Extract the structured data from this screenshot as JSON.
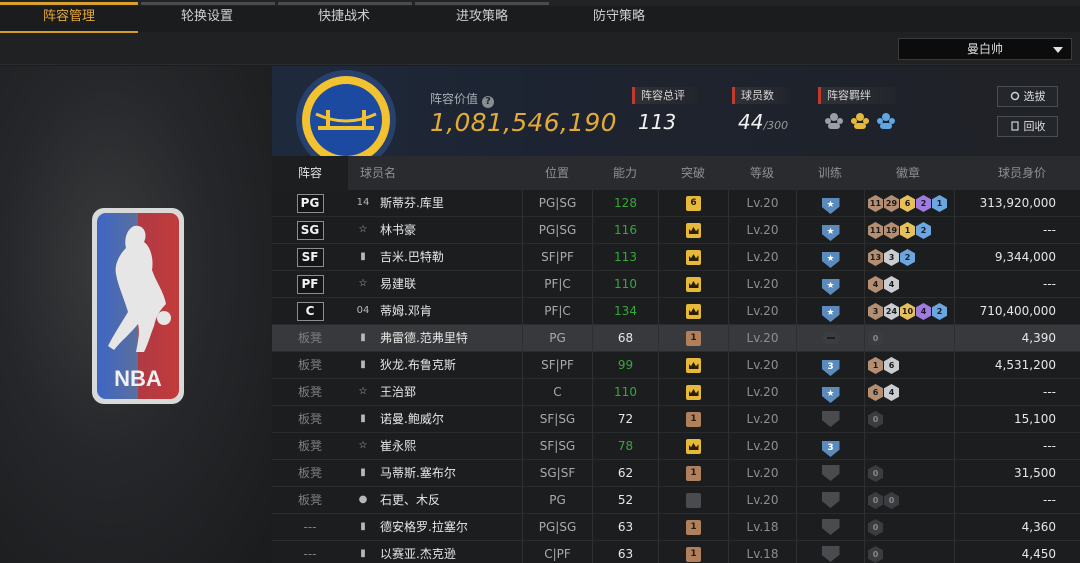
{
  "tabs": [
    "阵容管理",
    "轮换设置",
    "快捷战术",
    "进攻策略",
    "防守策略"
  ],
  "active_tab": 0,
  "dropdown": {
    "value": "曼白帅"
  },
  "header": {
    "value_label": "阵容价值",
    "value_amount": "1,081,546,190",
    "overall_label": "阵容总评",
    "overall_value": "113",
    "players_label": "球员数",
    "players_value": "44",
    "players_max": "/300",
    "bond_label": "阵容羁绊",
    "scout_button": "选拔",
    "recycle_button": "回收"
  },
  "columns": [
    "阵容",
    "球员名",
    "位置",
    "能力",
    "突破",
    "等级",
    "训练",
    "徽章",
    "球员身价"
  ],
  "colors": {
    "accent": "#d99b28",
    "value_gold": "#e3ab36",
    "green": "#35a83a"
  },
  "rows": [
    {
      "slot": "PG",
      "starter": true,
      "icon": "14",
      "name": "斯蒂芬.库里",
      "pos": "PG|SG",
      "ability": "128",
      "ability_green": true,
      "break": "6",
      "break_type": "gold-num",
      "level": "Lv.20",
      "train": "shield-star",
      "badges": [
        [
          "b",
          "11"
        ],
        [
          "b",
          "29"
        ],
        [
          "g",
          "6"
        ],
        [
          "p",
          "2"
        ],
        [
          "blue",
          "1"
        ]
      ],
      "price": "313,920,000"
    },
    {
      "slot": "SG",
      "starter": true,
      "icon": "star",
      "name": "林书豪",
      "pos": "PG|SG",
      "ability": "116",
      "ability_green": true,
      "break": "",
      "break_type": "gold-crown",
      "level": "Lv.20",
      "train": "shield-star",
      "badges": [
        [
          "b",
          "11"
        ],
        [
          "b",
          "19"
        ],
        [
          "g",
          "1"
        ],
        [
          "blue",
          "2"
        ]
      ],
      "price": "---"
    },
    {
      "slot": "SF",
      "starter": true,
      "icon": "bars",
      "name": "吉米.巴特勒",
      "pos": "SF|PF",
      "ability": "113",
      "ability_green": true,
      "break": "",
      "break_type": "gold-crown",
      "level": "Lv.20",
      "train": "shield-star",
      "badges": [
        [
          "b",
          "13"
        ],
        [
          "s",
          "3"
        ],
        [
          "blue",
          "2"
        ]
      ],
      "price": "9,344,000"
    },
    {
      "slot": "PF",
      "starter": true,
      "icon": "star",
      "name": "易建联",
      "pos": "PF|C",
      "ability": "110",
      "ability_green": true,
      "break": "",
      "break_type": "gold-crown",
      "level": "Lv.20",
      "train": "shield-star",
      "badges": [
        [
          "b",
          "4"
        ],
        [
          "s",
          "4"
        ]
      ],
      "price": "---"
    },
    {
      "slot": "C",
      "starter": true,
      "icon": "04",
      "name": "蒂姆.邓肯",
      "pos": "PF|C",
      "ability": "134",
      "ability_green": true,
      "break": "",
      "break_type": "gold-crown",
      "level": "Lv.20",
      "train": "shield-star",
      "badges": [
        [
          "b",
          "3"
        ],
        [
          "s",
          "24"
        ],
        [
          "g",
          "10"
        ],
        [
          "p",
          "4"
        ],
        [
          "blue",
          "2"
        ]
      ],
      "price": "710,400,000"
    },
    {
      "slot": "板凳",
      "starter": false,
      "icon": "bars",
      "name": "弗雷德.范弗里特",
      "pos": "PG",
      "ability": "68",
      "ability_green": false,
      "break": "1",
      "break_type": "bronze",
      "level": "Lv.20",
      "train": "dash",
      "badges": [
        [
          "z",
          "0"
        ]
      ],
      "price": "4,390",
      "highlight": true
    },
    {
      "slot": "板凳",
      "starter": false,
      "icon": "bars",
      "name": "狄龙.布鲁克斯",
      "pos": "SF|PF",
      "ability": "99",
      "ability_green": true,
      "break": "",
      "break_type": "gold-crown",
      "level": "Lv.20",
      "train": "shield-3",
      "badges": [
        [
          "b",
          "1"
        ],
        [
          "s",
          "6"
        ]
      ],
      "price": "4,531,200"
    },
    {
      "slot": "板凳",
      "starter": false,
      "icon": "star",
      "name": "王治郅",
      "pos": "C",
      "ability": "110",
      "ability_green": true,
      "break": "",
      "break_type": "gold-crown",
      "level": "Lv.20",
      "train": "shield-star",
      "badges": [
        [
          "b",
          "6"
        ],
        [
          "s",
          "4"
        ]
      ],
      "price": "---"
    },
    {
      "slot": "板凳",
      "starter": false,
      "icon": "bars",
      "name": "诺曼.鲍威尔",
      "pos": "SF|SG",
      "ability": "72",
      "ability_green": false,
      "break": "1",
      "break_type": "bronze",
      "level": "Lv.20",
      "train": "shield-dim",
      "badges": [
        [
          "z",
          "0"
        ]
      ],
      "price": "15,100"
    },
    {
      "slot": "板凳",
      "starter": false,
      "icon": "star",
      "name": "崔永熙",
      "pos": "SF|SG",
      "ability": "78",
      "ability_green": true,
      "break": "",
      "break_type": "gold-crown",
      "level": "Lv.20",
      "train": "shield-3",
      "badges": [],
      "price": "---"
    },
    {
      "slot": "板凳",
      "starter": false,
      "icon": "bars",
      "name": "马蒂斯.塞布尔",
      "pos": "SG|SF",
      "ability": "62",
      "ability_green": false,
      "break": "1",
      "break_type": "bronze",
      "level": "Lv.20",
      "train": "shield-dim",
      "badges": [
        [
          "z",
          "0"
        ]
      ],
      "price": "31,500"
    },
    {
      "slot": "板凳",
      "starter": false,
      "icon": "person",
      "name": "石更、木反",
      "pos": "PG",
      "ability": "52",
      "ability_green": false,
      "break": "",
      "break_type": "gray",
      "level": "Lv.20",
      "train": "shield-dim",
      "badges": [
        [
          "z",
          "0"
        ],
        [
          "z",
          "0"
        ]
      ],
      "price": "---"
    },
    {
      "slot": "---",
      "starter": false,
      "icon": "bars",
      "name": "德安格罗.拉塞尔",
      "pos": "PG|SG",
      "ability": "63",
      "ability_green": false,
      "break": "1",
      "break_type": "bronze",
      "level": "Lv.18",
      "train": "shield-dim",
      "badges": [
        [
          "z",
          "0"
        ]
      ],
      "price": "4,360"
    },
    {
      "slot": "---",
      "starter": false,
      "icon": "bars",
      "name": "以赛亚.杰克逊",
      "pos": "C|PF",
      "ability": "63",
      "ability_green": false,
      "break": "1",
      "break_type": "bronze",
      "level": "Lv.18",
      "train": "shield-dim",
      "badges": [
        [
          "z",
          "0"
        ]
      ],
      "price": "4,450"
    }
  ]
}
